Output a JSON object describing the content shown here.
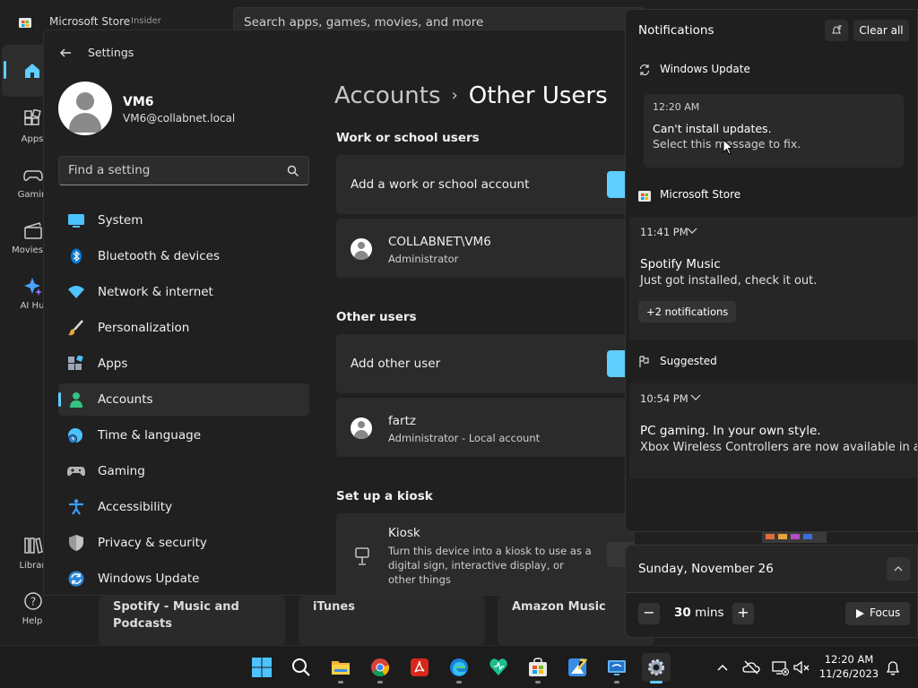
{
  "store": {
    "title": "Microsoft Store",
    "tag": "Insider",
    "search_placeholder": "Search apps, games, movies, and more",
    "nav": [
      {
        "label": "",
        "icon": "home-icon"
      },
      {
        "label": "Apps",
        "icon": "apps-icon"
      },
      {
        "label": "Gamin",
        "icon": "gaming-icon"
      },
      {
        "label": "Movies &",
        "icon": "movies-icon"
      },
      {
        "label": "AI Hu",
        "icon": "ai-hub-icon"
      },
      {
        "label": "Librar",
        "icon": "library-icon"
      },
      {
        "label": "Help",
        "icon": "help-icon"
      }
    ],
    "cards": [
      "Spotify - Music and Podcasts",
      "iTunes",
      "Amazon Music"
    ]
  },
  "settings": {
    "app_title": "Settings",
    "user": {
      "name": "VM6",
      "email": "VM6@collabnet.local"
    },
    "find_placeholder": "Find a setting",
    "sidebar": [
      {
        "label": "System",
        "icon": "system-icon",
        "color": "#4cc2ff"
      },
      {
        "label": "Bluetooth & devices",
        "icon": "bluetooth-icon",
        "color": "#0078d4"
      },
      {
        "label": "Network & internet",
        "icon": "network-icon",
        "color": "#4cc2ff"
      },
      {
        "label": "Personalization",
        "icon": "personalization-icon",
        "color": "#e8a33d"
      },
      {
        "label": "Apps",
        "icon": "apps-icon",
        "color": "#9aa7b8"
      },
      {
        "label": "Accounts",
        "icon": "accounts-icon",
        "color": "#33c481"
      },
      {
        "label": "Time & language",
        "icon": "time-language-icon",
        "color": "#4cc2ff"
      },
      {
        "label": "Gaming",
        "icon": "gaming-icon",
        "color": "#a0a0a0"
      },
      {
        "label": "Accessibility",
        "icon": "accessibility-icon",
        "color": "#3b9cff"
      },
      {
        "label": "Privacy & security",
        "icon": "shield-icon",
        "color": "#a0a0a0"
      },
      {
        "label": "Windows Update",
        "icon": "windows-update-icon",
        "color": "#2b88d8"
      }
    ],
    "active_index": 5,
    "breadcrumb": {
      "parent": "Accounts",
      "separator": "›",
      "current": "Other Users"
    },
    "work_section": "Work or school users",
    "add_work": "Add a work or school account",
    "work_user": {
      "name": "COLLABNET\\VM6",
      "role": "Administrator"
    },
    "other_section": "Other users",
    "add_other": "Add other user",
    "other_user": {
      "name": "fartz",
      "role": "Administrator - Local account"
    },
    "kiosk_section": "Set up a kiosk",
    "kiosk": {
      "title": "Kiosk",
      "desc": "Turn this device into a kiosk to use as a digital sign, interactive display, or other things"
    }
  },
  "notifications": {
    "title": "Notifications",
    "clear_all": "Clear all",
    "groups": [
      {
        "name": "Windows Update",
        "icon": "refresh-icon"
      },
      {
        "name": "Microsoft Store",
        "icon": "store-icon"
      },
      {
        "name": "Suggested",
        "icon": "suggested-icon"
      }
    ],
    "update_toast": {
      "time": "12:20 AM",
      "head": "Can't install updates.",
      "body": "Select this message to fix."
    },
    "store_card": {
      "time": "11:41 PM",
      "head": "Spotify Music",
      "body": "Just got installed, check it out.",
      "more": "+2 notifications"
    },
    "suggested_card": {
      "time": "10:54 PM",
      "head": "PC gaming. In your own style.",
      "body": "Xbox Wireless Controllers are now available in a"
    }
  },
  "calendar": {
    "date": "Sunday, November 26",
    "minus": "−",
    "plus": "+",
    "minutes": "30",
    "unit": "mins",
    "focus": "Focus"
  },
  "taskbar": {
    "apps": [
      "start-icon",
      "search-icon",
      "file-explorer-icon",
      "chrome-icon",
      "acrobat-icon",
      "edge-icon",
      "app-icon",
      "store-icon",
      "paint-icon",
      "remote-desktop-icon",
      "settings-icon"
    ],
    "active_app": "settings-icon",
    "time": "12:20 AM",
    "date": "11/26/2023"
  },
  "colors": {
    "accent": "#60cdff",
    "background": "#202020"
  }
}
